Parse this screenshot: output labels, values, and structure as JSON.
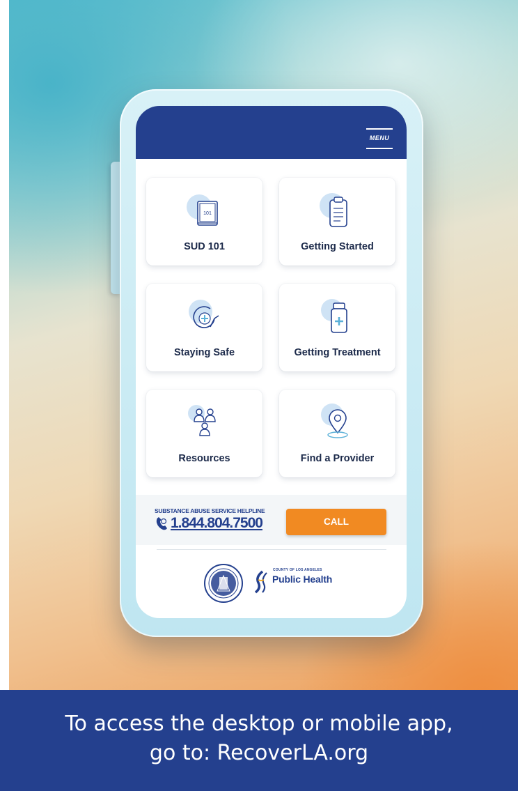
{
  "app": {
    "menu_label": "MENU"
  },
  "tiles": [
    {
      "label": "SUD 101",
      "icon": "book-101-icon"
    },
    {
      "label": "Getting Started",
      "icon": "clipboard-icon"
    },
    {
      "label": "Staying Safe",
      "icon": "cycle-health-icon"
    },
    {
      "label": "Getting Treatment",
      "icon": "medicine-bottle-icon"
    },
    {
      "label": "Resources",
      "icon": "people-group-icon"
    },
    {
      "label": "Find a Provider",
      "icon": "location-pin-icon"
    }
  ],
  "book_icon_text": "101",
  "helpline": {
    "title": "SUBSTANCE ABUSE SERVICE HELPLINE",
    "number": "1.844.804.7500",
    "call_label": "CALL"
  },
  "branding": {
    "county_text": "COUNTY OF LOS ANGELES",
    "dept_text": "Public Health"
  },
  "footer": {
    "line1": "To access the desktop or mobile app,",
    "line2": "go to: RecoverLA.org"
  },
  "colors": {
    "brand_blue": "#24408e",
    "call_orange": "#f18a22",
    "icon_accent": "#cfe3f5"
  }
}
